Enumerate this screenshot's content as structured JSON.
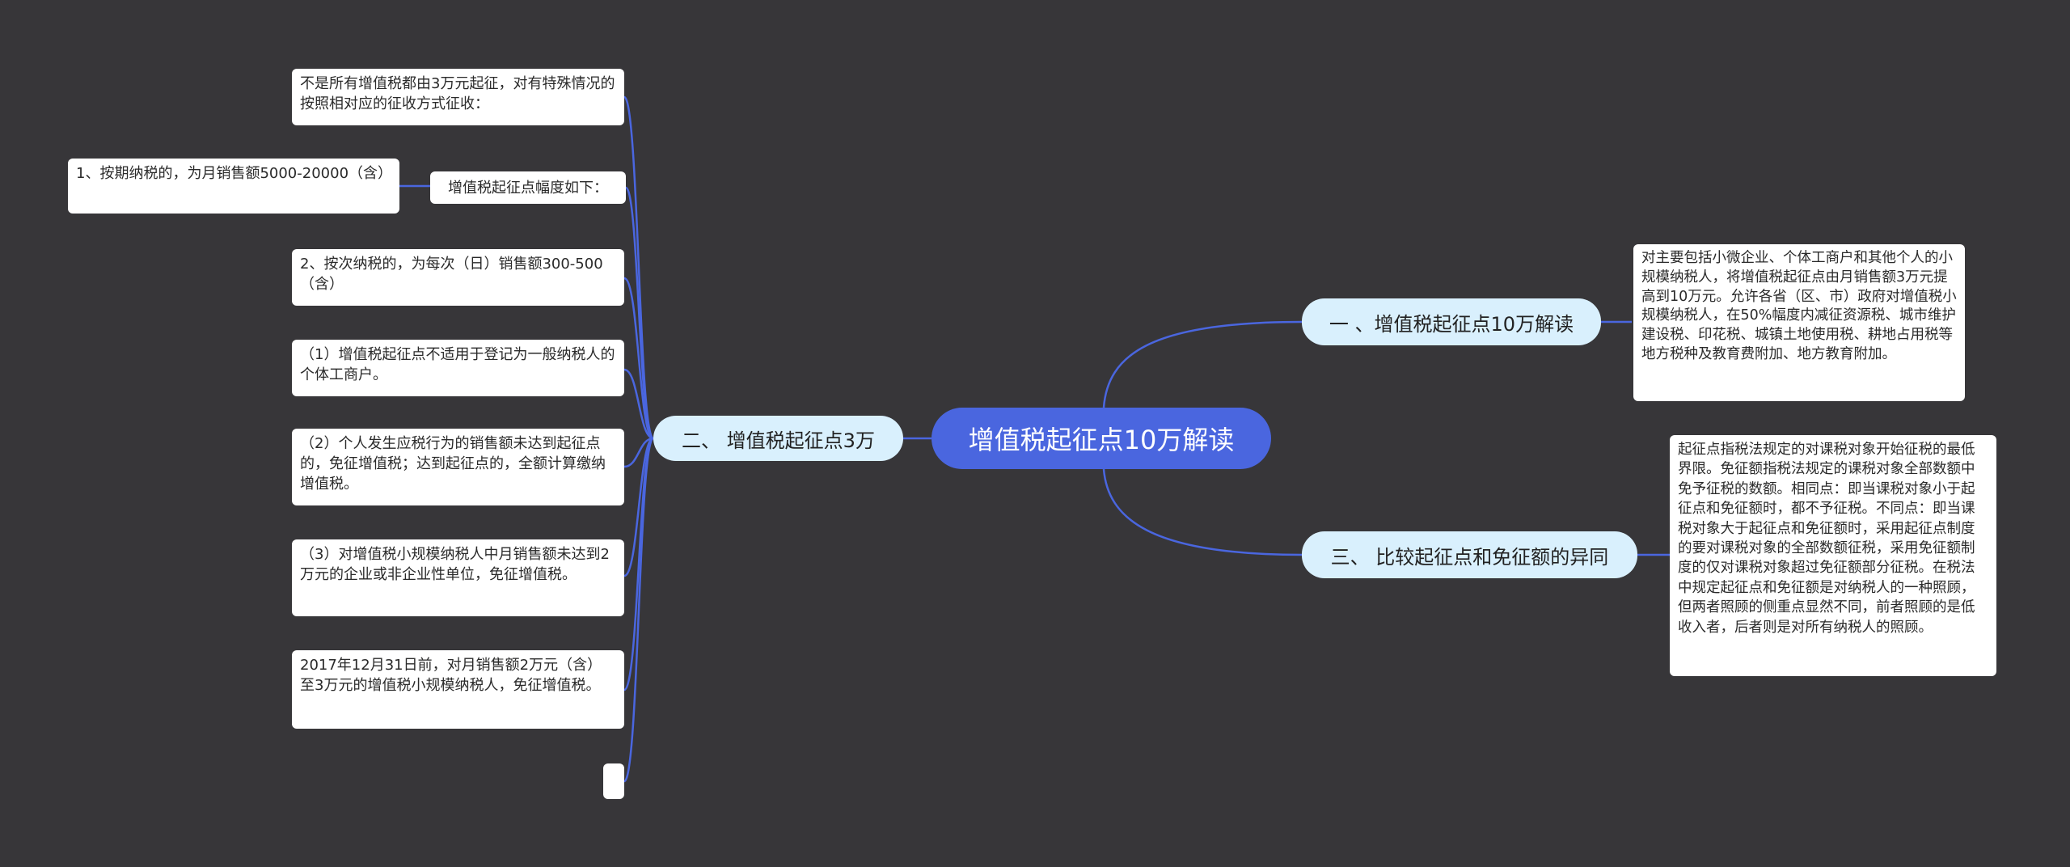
{
  "root": {
    "label": "增值税起征点10万解读"
  },
  "branches": {
    "b1": {
      "label": "一 、增值税起征点10万解读",
      "text": "对主要包括小微企业、个体工商户和其他个人的小规模纳税人，将增值税起征点由月销售额3万元提高到10万元。允许各省（区、市）政府对增值税小规模纳税人，在50%幅度内减征资源税、城市维护建设税、印花税、城镇土地使用税、耕地占用税等地方税种及教育费附加、地方教育附加。"
    },
    "b2": {
      "label": "二、 增值税起征点3万",
      "items": [
        "不是所有增值税都由3万元起征，对有特殊情况的按照相对应的征收方式征收：",
        "增值税起征点幅度如下：",
        "2、按次纳税的，为每次（日）销售额300-500（含）",
        "（1）增值税起征点不适用于登记为一般纳税人的个体工商户。",
        "（2）个人发生应税行为的销售额未达到起征点的，免征增值税；达到起征点的，全额计算缴纳增值税。",
        "（3）对增值税小规模纳税人中月销售额未达到2万元的企业或非企业性单位，免征增值税。",
        "2017年12月31日前，对月销售额2万元（含）至3万元的增值税小规模纳税人，免征增值税。",
        ""
      ],
      "subitem": "1、按期纳税的，为月销售额5000-20000（含）"
    },
    "b3": {
      "label": "三、 比较起征点和免征额的异同",
      "text": "起征点指税法规定的对课税对象开始征税的最低界限。免征额指税法规定的课税对象全部数额中免予征税的数额。相同点：即当课税对象小于起征点和免征额时，都不予征税。不同点：即当课税对象大于起征点和免征额时，采用起征点制度的要对课税对象的全部数额征税，采用免征额制度的仅对课税对象超过免征额部分征税。在税法中规定起征点和免征额是对纳税人的一种照顾，但两者照顾的侧重点显然不同，前者照顾的是低收入者，后者则是对所有纳税人的照顾。"
    }
  },
  "colors": {
    "background": "#373639",
    "root_fill": "#4a66df",
    "branch_fill": "#d9f0fd",
    "leaf_fill": "#ffffff",
    "connector": "#4a66df"
  }
}
